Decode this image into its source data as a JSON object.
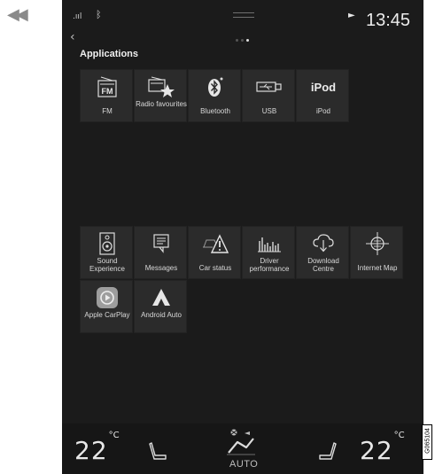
{
  "outer": {
    "rewind_icon": "double-left-arrow",
    "reference_code": "G065104"
  },
  "status_bar": {
    "signal_label": ".ııl",
    "bluetooth_glyph": "ᛒ",
    "play_glyph": "►",
    "time": "13:45"
  },
  "nav": {
    "back_glyph": "‹"
  },
  "section_title": "Applications",
  "apps_row1": [
    {
      "label": "FM",
      "icon": "radio-fm-icon"
    },
    {
      "label": "Radio favourites",
      "icon": "radio-favourite-icon"
    },
    {
      "label": "Bluetooth",
      "icon": "bluetooth-icon"
    },
    {
      "label": "USB",
      "icon": "usb-icon"
    },
    {
      "label": "iPod",
      "icon": "ipod-icon",
      "icon_text": "iPod"
    }
  ],
  "apps_row2": [
    {
      "label": "Sound Experience",
      "icon": "speaker-icon"
    },
    {
      "label": "Messages",
      "icon": "message-icon"
    },
    {
      "label": "Car status",
      "icon": "car-warning-icon"
    },
    {
      "label": "Driver performance",
      "icon": "bar-chart-icon"
    },
    {
      "label": "Download Centre",
      "icon": "cloud-download-icon"
    },
    {
      "label": "Internet Map",
      "icon": "crosshair-map-icon"
    }
  ],
  "apps_row3": [
    {
      "label": "Apple CarPlay",
      "icon": "carplay-icon"
    },
    {
      "label": "Android Auto",
      "icon": "android-auto-icon"
    }
  ],
  "climate": {
    "left_temp": "22",
    "right_temp": "22",
    "unit": "°C",
    "fan_mode": "AUTO"
  }
}
